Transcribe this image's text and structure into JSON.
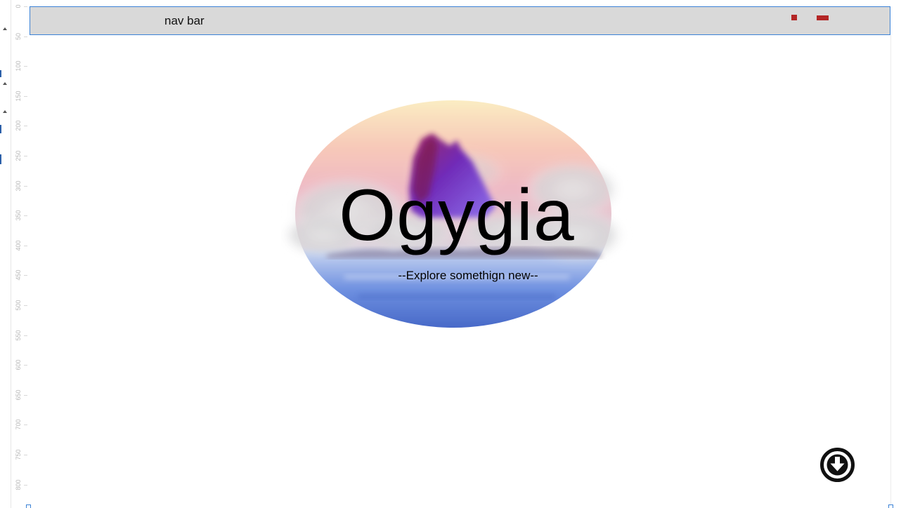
{
  "ruler": {
    "ticks": [
      "0",
      "50",
      "100",
      "150",
      "200",
      "250",
      "300",
      "350",
      "400",
      "450",
      "500",
      "550",
      "600",
      "650",
      "700",
      "750",
      "800"
    ]
  },
  "navbar": {
    "label": "nav bar",
    "bg_color": "#d9d9d9",
    "border_color": "#3b82d6",
    "mark_color": "#b32626"
  },
  "hero": {
    "title": "Ogygia",
    "subtitle": "--Explore somethign new--",
    "image_icon": "island-watercolor-image"
  },
  "scroll_button": {
    "icon": "arrow-down-circle-icon"
  }
}
